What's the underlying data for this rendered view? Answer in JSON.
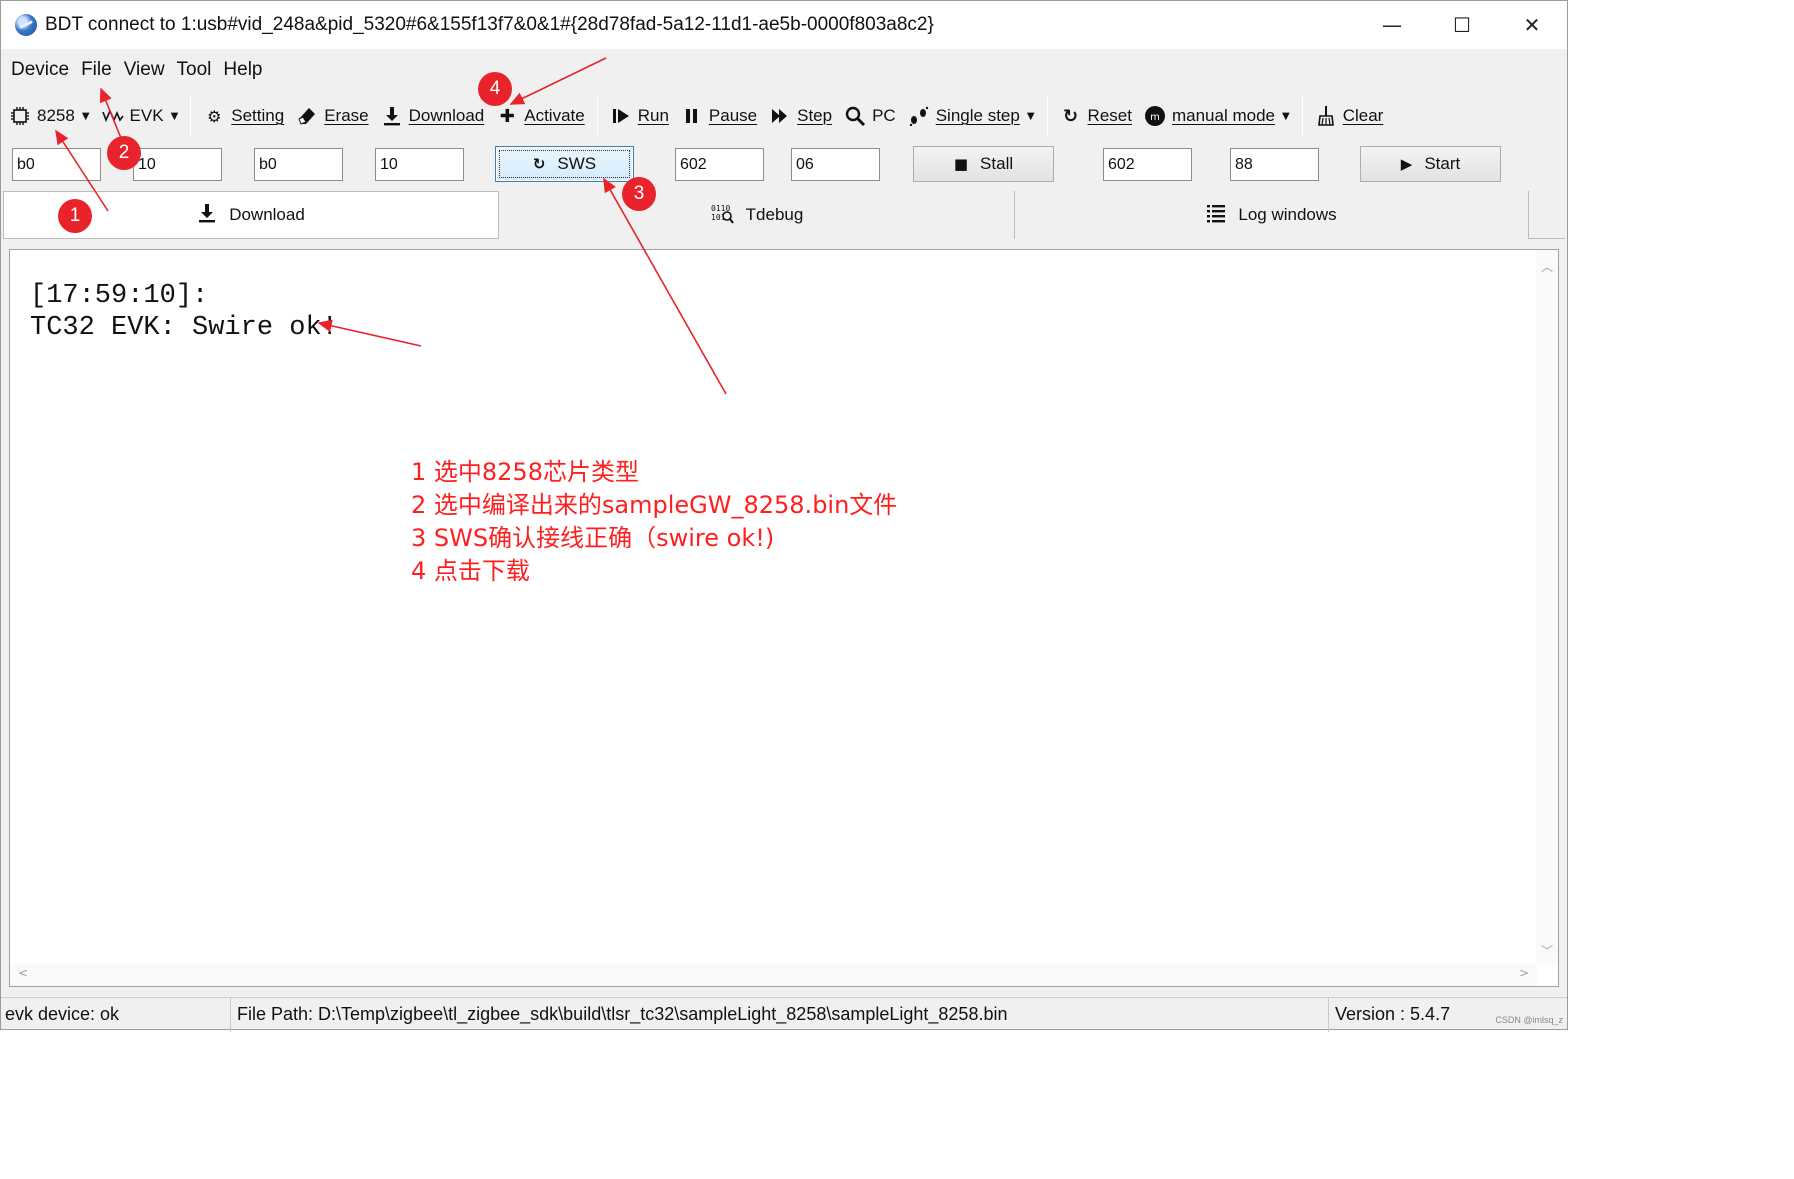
{
  "window": {
    "title": "BDT connect to 1:usb#vid_248a&pid_5320#6&155f13f7&0&1#{28d78fad-5a12-11d1-ae5b-0000f803a8c2}",
    "minimize": "—",
    "maximize": "☐",
    "close": "✕"
  },
  "menu": {
    "items": [
      "Device",
      "File",
      "View",
      "Tool",
      "Help"
    ]
  },
  "toolbar": {
    "chip": "8258",
    "evk": "EVK",
    "setting": "Setting",
    "erase": "Erase",
    "download": "Download",
    "activate": "Activate",
    "run": "Run",
    "pause": "Pause",
    "step": "Step",
    "pc": "PC",
    "single_step": "Single step",
    "reset": "Reset",
    "manual_mode": "manual mode",
    "clear": "Clear"
  },
  "inputs": {
    "f1": "b0",
    "f2": "10",
    "f3": "b0",
    "f4": "10",
    "sws": "SWS",
    "f5": "602",
    "f6": "06",
    "stall": "Stall",
    "f7": "602",
    "f8": "88",
    "start": "Start"
  },
  "tabs": {
    "download": "Download",
    "tdebug": "Tdebug",
    "log": "Log windows"
  },
  "log": {
    "line1": "[17:59:10]:",
    "line2": "TC32 EVK: Swire ok!"
  },
  "annotation": {
    "step1": "1 选中8258芯片类型",
    "step2": "2 选中编译出来的sampleGW_8258.bin文件",
    "step3": "3 SWS确认接线正确（swire ok!)",
    "step4": "4 点击下载",
    "m1": "1",
    "m2": "2",
    "m3": "3",
    "m4": "4",
    "color": "#e8232b"
  },
  "status": {
    "device": "evk device: ok",
    "file_path": "File Path:  D:\\Temp\\zigbee\\tl_zigbee_sdk\\build\\tlsr_tc32\\sampleLight_8258\\sampleLight_8258.bin",
    "version": "Version : 5.4.7"
  },
  "watermark": "CSDN @imlsq_z"
}
